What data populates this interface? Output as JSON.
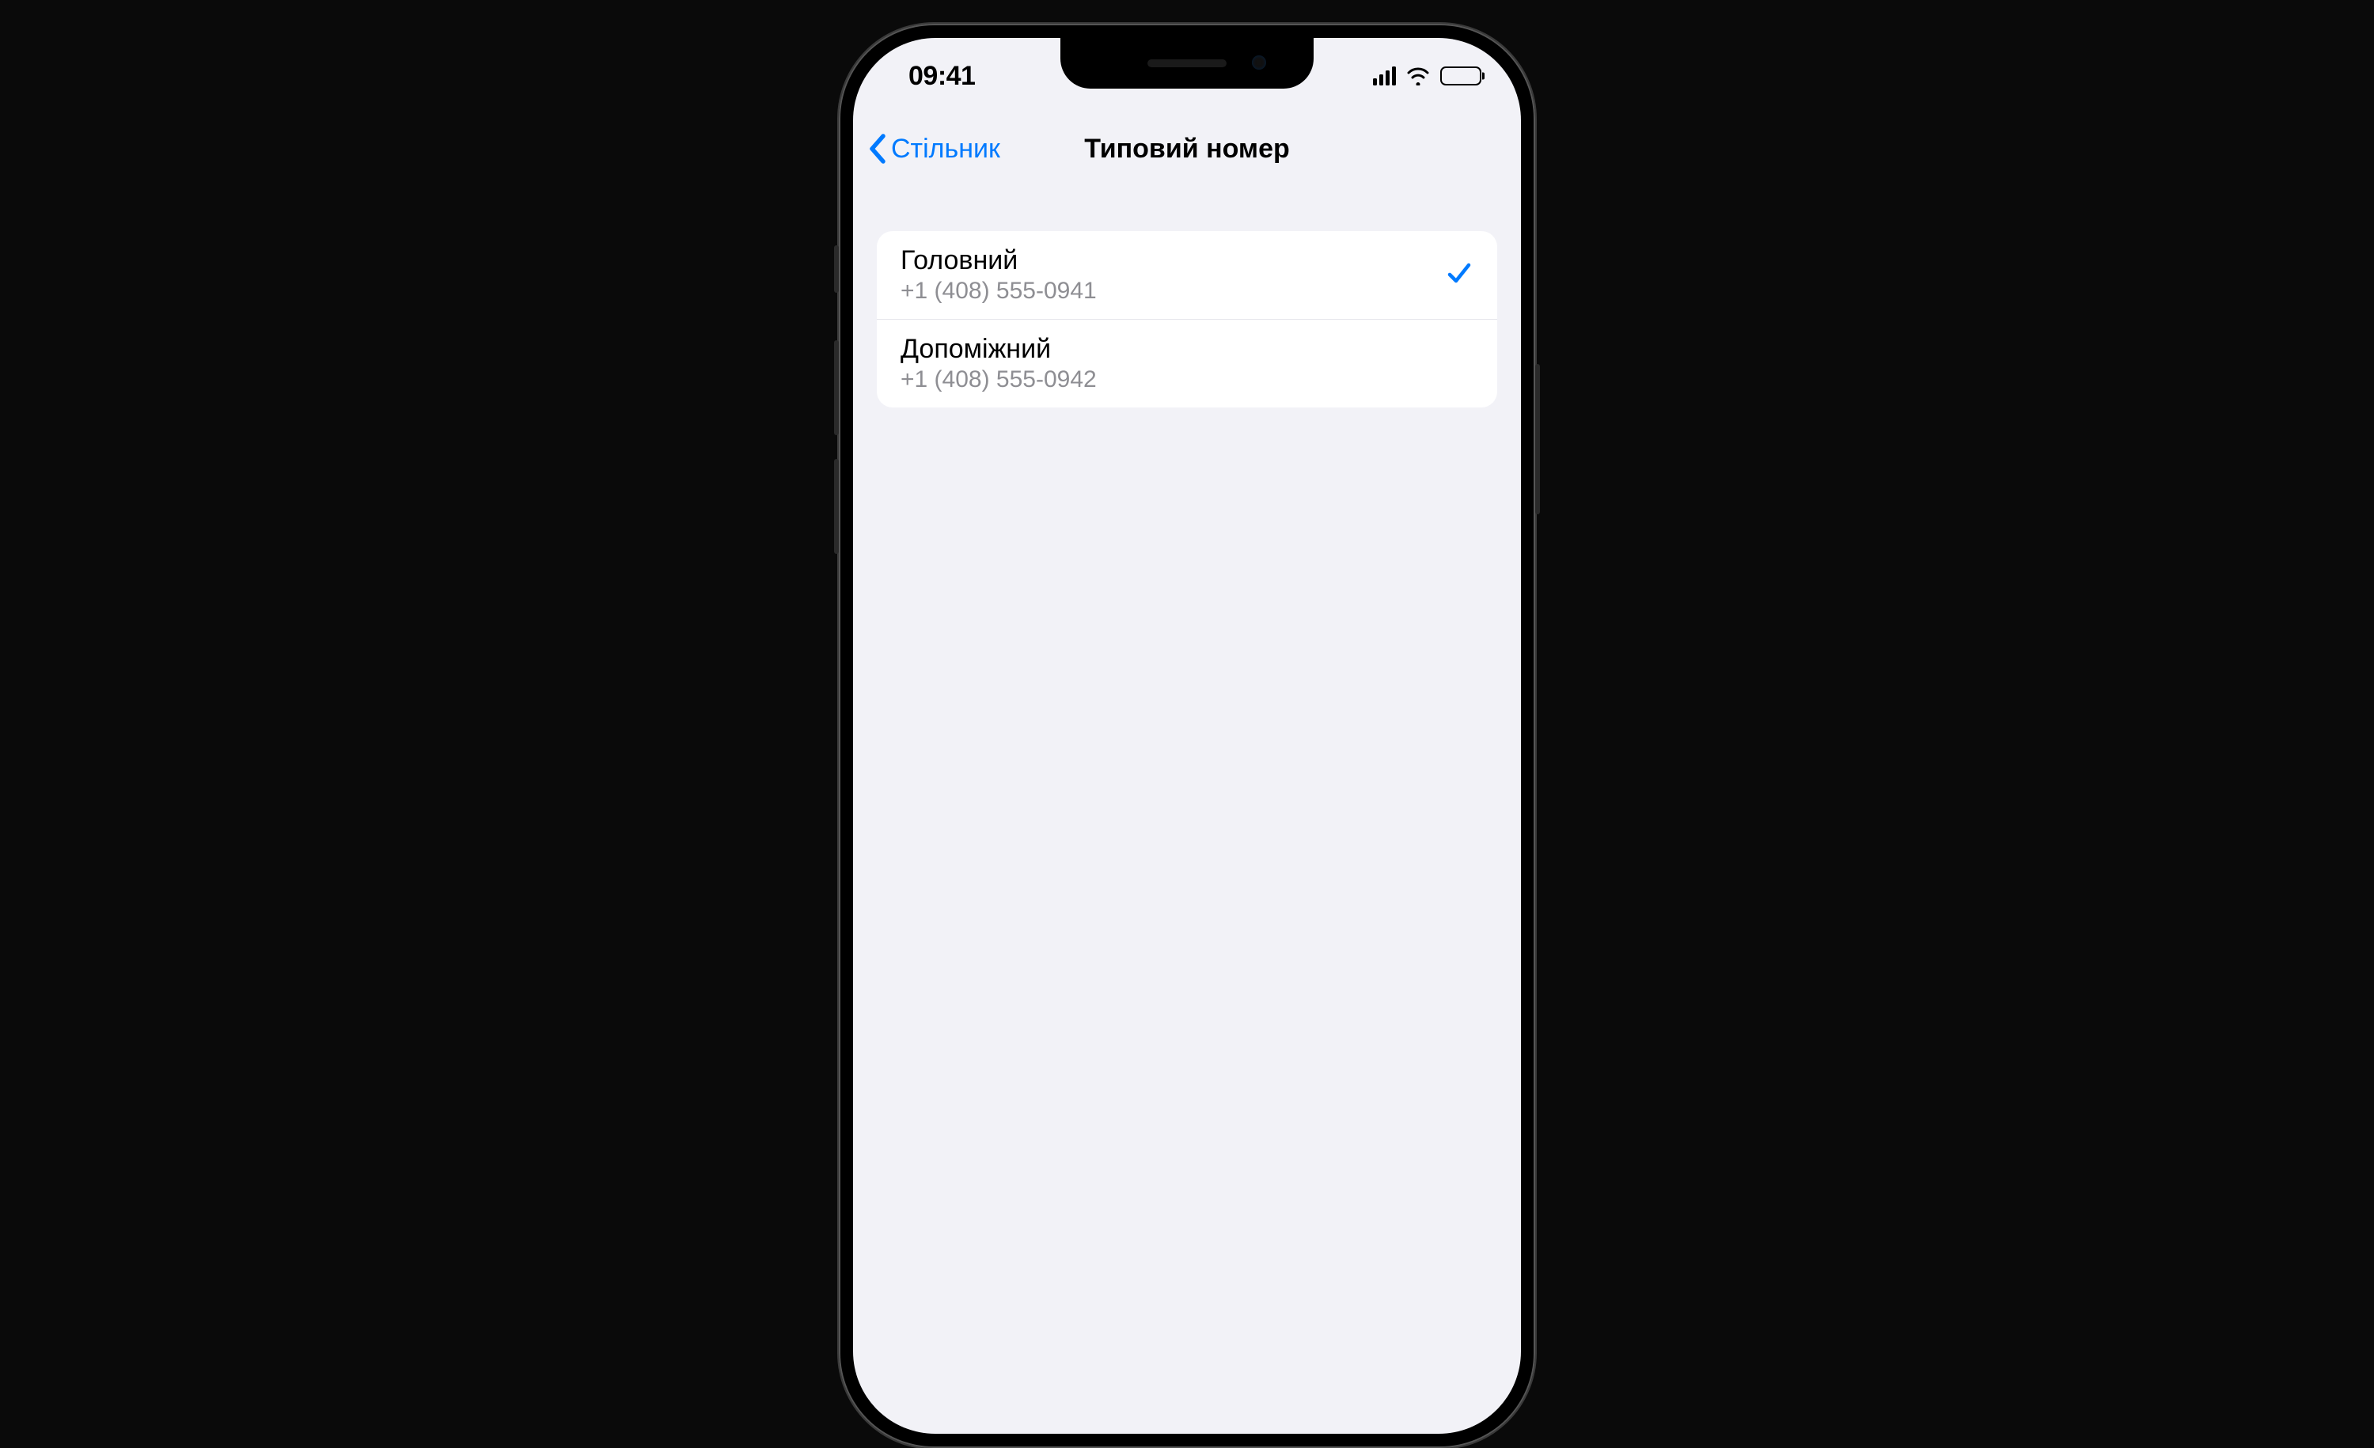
{
  "status": {
    "time": "09:41"
  },
  "nav": {
    "back_label": "Стільник",
    "title": "Типовий номер"
  },
  "options": [
    {
      "label": "Головний",
      "number": "+1 (408) 555-0941",
      "selected": true
    },
    {
      "label": "Допоміжний",
      "number": "+1 (408) 555-0942",
      "selected": false
    }
  ],
  "colors": {
    "accent": "#007aff",
    "background": "#f2f2f7"
  }
}
